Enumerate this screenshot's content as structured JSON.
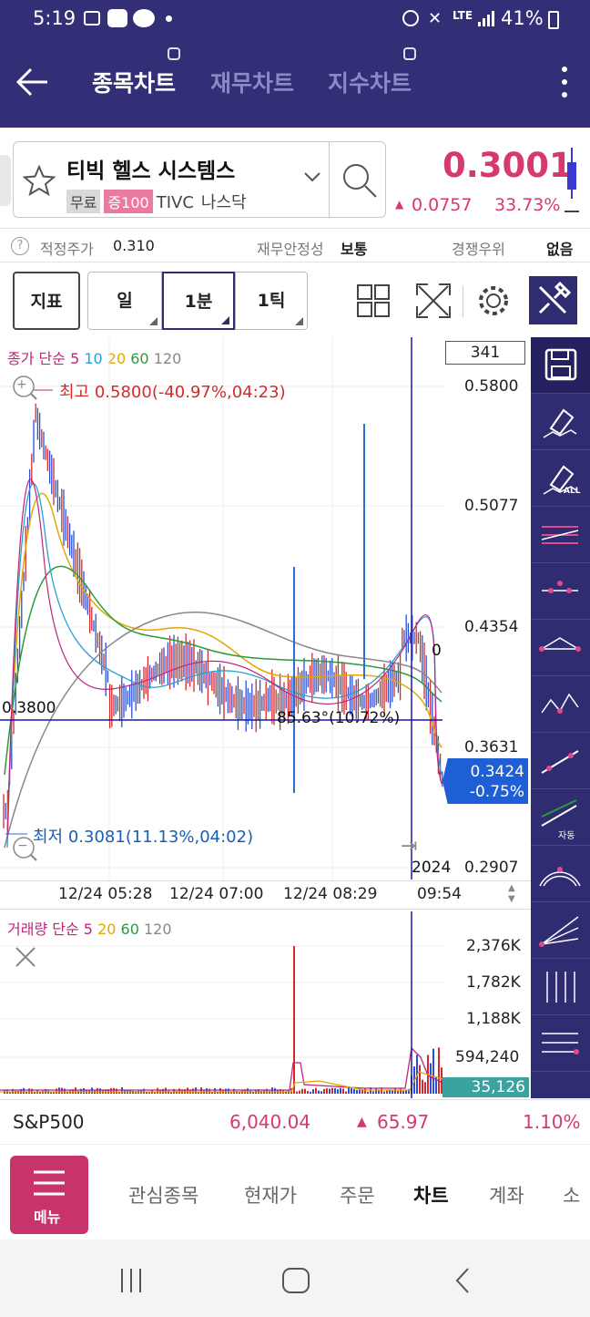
{
  "status_bar": {
    "time": "5:19",
    "battery": "41%",
    "network": "LTE"
  },
  "header": {
    "tabs": [
      "종목차트",
      "재무차트",
      "지수차트"
    ],
    "active_tab": 0
  },
  "stock": {
    "name": "티빅 헬스 시스템스",
    "tag_free": "무료",
    "tag_margin": "증100",
    "ticker": "TIVC",
    "market": "나스닥",
    "price": "0.3001",
    "change": "0.0757",
    "change_pct": "33.73%",
    "color_up": "#d63a6c"
  },
  "info_row": {
    "fair_label": "적정주가",
    "fair_value": "0.310",
    "stability_label": "재무안정성",
    "stability_value": "보통",
    "competition_label": "경쟁우위",
    "competition_value": "없음"
  },
  "toolbar": {
    "indicator": "지표",
    "day": "일",
    "minute": "1분",
    "tick": "1틱"
  },
  "chart": {
    "legend_prefix": "종가 단순",
    "ma": [
      "5",
      "10",
      "20",
      "60",
      "120"
    ],
    "ma_colors": [
      "#c0247a",
      "#2a9fd6",
      "#e0a800",
      "#2c9a3c",
      "#888888"
    ],
    "count_box": "341",
    "y_labels": [
      "0.5800",
      "0.5077",
      "0.4354",
      "0.3631",
      "0.2907"
    ],
    "high_label": "최고 0.5800(-40.97%,04:23)",
    "low_label": "최저 0.3081(11.13%,04:02)",
    "hline_value": "0.3800",
    "hline_note": "85.63°(10.72%)",
    "current_price": "0.3424",
    "current_pct": "-0.75%",
    "zero_label": "0",
    "year_label": "2024",
    "x_labels": [
      "12/24 05:28",
      "12/24 07:00",
      "12/24 08:29",
      "09:54"
    ]
  },
  "volume": {
    "legend_prefix": "거래량 단순",
    "ma": [
      "5",
      "20",
      "60",
      "120"
    ],
    "ma_colors": [
      "#c0247a",
      "#e0a800",
      "#2c9a3c",
      "#888888"
    ],
    "y_labels": [
      "2,376K",
      "1,782K",
      "1,188K",
      "594,240"
    ],
    "current": "35,126"
  },
  "index": {
    "name": "S&P500",
    "value": "6,040.04",
    "change": "65.97",
    "pct": "1.10%"
  },
  "bottom_menu": {
    "menu_label": "메뉴",
    "items": [
      "관심종목",
      "현재가",
      "주문",
      "차트",
      "계좌",
      "소"
    ],
    "active": "차트"
  },
  "rtool_icons": [
    "save-icon",
    "eraser-icon",
    "eraser-all-icon",
    "hcl-lines-icon",
    "point-line-icon",
    "triangle-line-icon",
    "zigzag-icon",
    "trend-line-icon",
    "auto-trend-icon",
    "arc-icon",
    "fan-icon",
    "vertical-lines-icon",
    "horizontal-lines-icon"
  ],
  "rtool_auto_label": "자동",
  "rtool_all_label": "ALL"
}
